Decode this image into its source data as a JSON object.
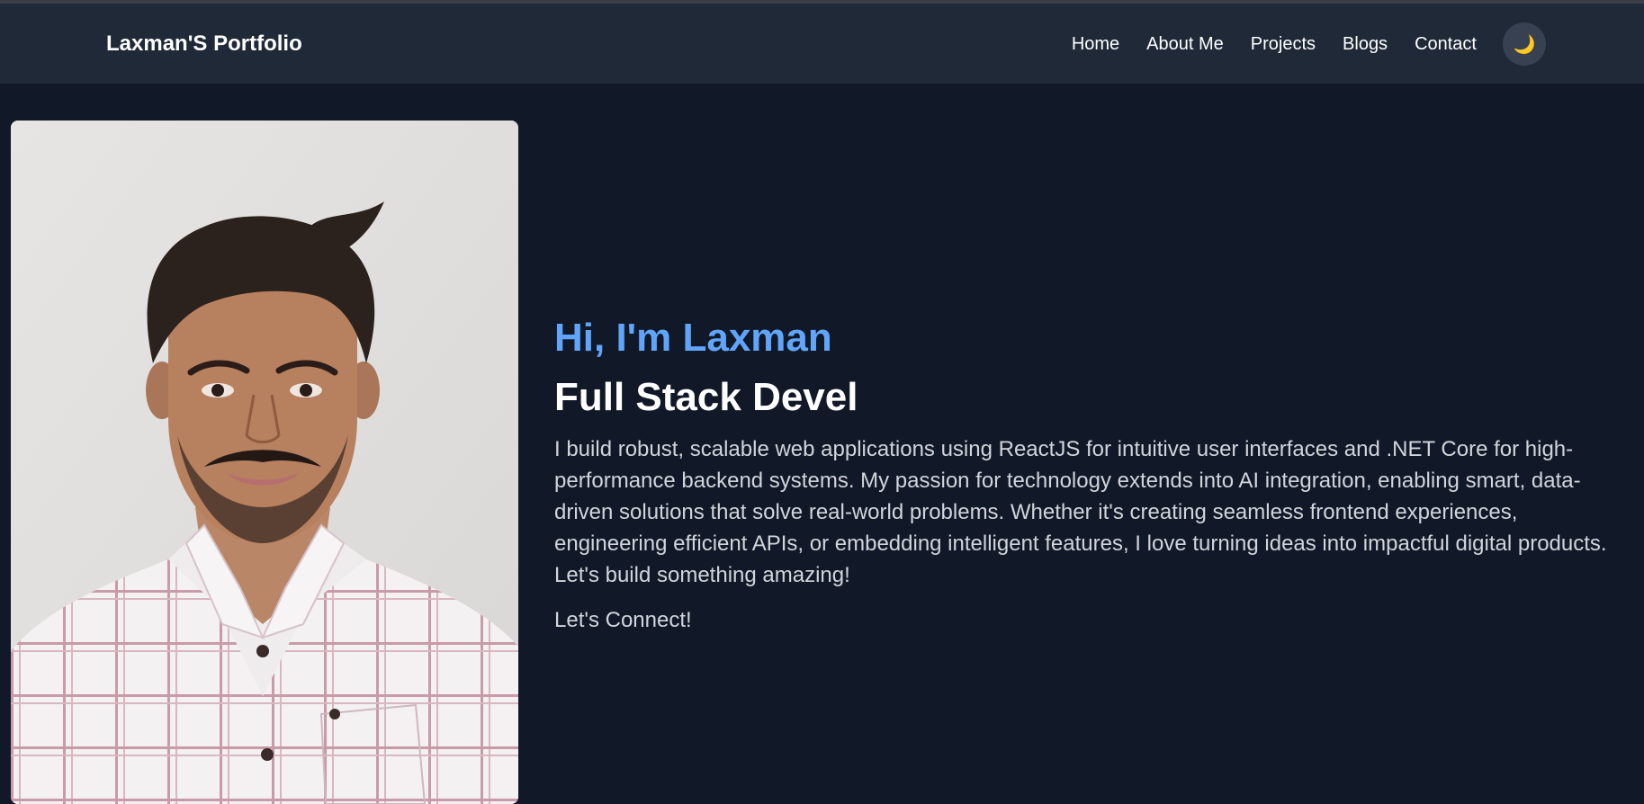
{
  "brand": {
    "title": "Laxman'S Portfolio"
  },
  "nav": {
    "items": [
      {
        "label": "Home"
      },
      {
        "label": "About Me"
      },
      {
        "label": "Projects"
      },
      {
        "label": "Blogs"
      },
      {
        "label": "Contact"
      }
    ],
    "theme_toggle_icon": "🌙"
  },
  "hero": {
    "greeting": "Hi, I'm Laxman",
    "role": "Full Stack Devel",
    "bio": "I build robust, scalable web applications using ReactJS for intuitive user interfaces and .NET Core for high-performance backend systems. My passion for technology extends into AI integration, enabling smart, data-driven solutions that solve real-world problems. Whether it's creating seamless frontend experiences, engineering efficient APIs, or embedding intelligent features, I love turning ideas into impactful digital products. Let's build something amazing!",
    "cta": "Let's Connect!"
  },
  "colors": {
    "page_bg": "#111827",
    "navbar_bg": "#1f2937",
    "accent": "#60a5fa",
    "text_primary": "#ffffff",
    "text_secondary": "#d1d5db"
  },
  "icons": {
    "theme_toggle": "moon-icon"
  }
}
